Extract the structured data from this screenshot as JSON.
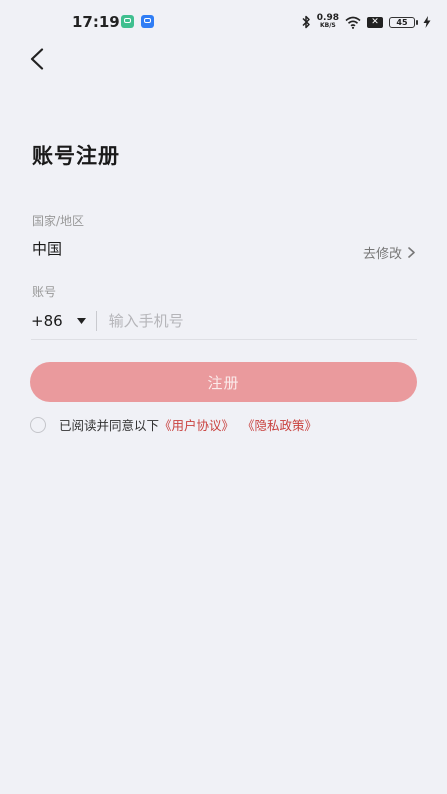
{
  "status_bar": {
    "time": "17:19",
    "net_speed_value": "0.98",
    "net_speed_unit": "KB/S",
    "sim_label": "✕",
    "battery_level": "45"
  },
  "header": {
    "back_icon": "chevron-left-icon"
  },
  "page": {
    "title": "账号注册"
  },
  "region": {
    "label": "国家/地区",
    "value": "中国",
    "change_label": "去修改"
  },
  "account": {
    "label": "账号",
    "country_code": "+86",
    "phone_placeholder": "输入手机号",
    "phone_value": ""
  },
  "actions": {
    "register_label": "注册",
    "register_color": "#ea9a9d"
  },
  "agreement": {
    "prefix": "已阅读并同意以下",
    "user_agreement": "《用户协议》",
    "privacy_policy": "《隐私政策》",
    "link_color": "#c9423f"
  }
}
